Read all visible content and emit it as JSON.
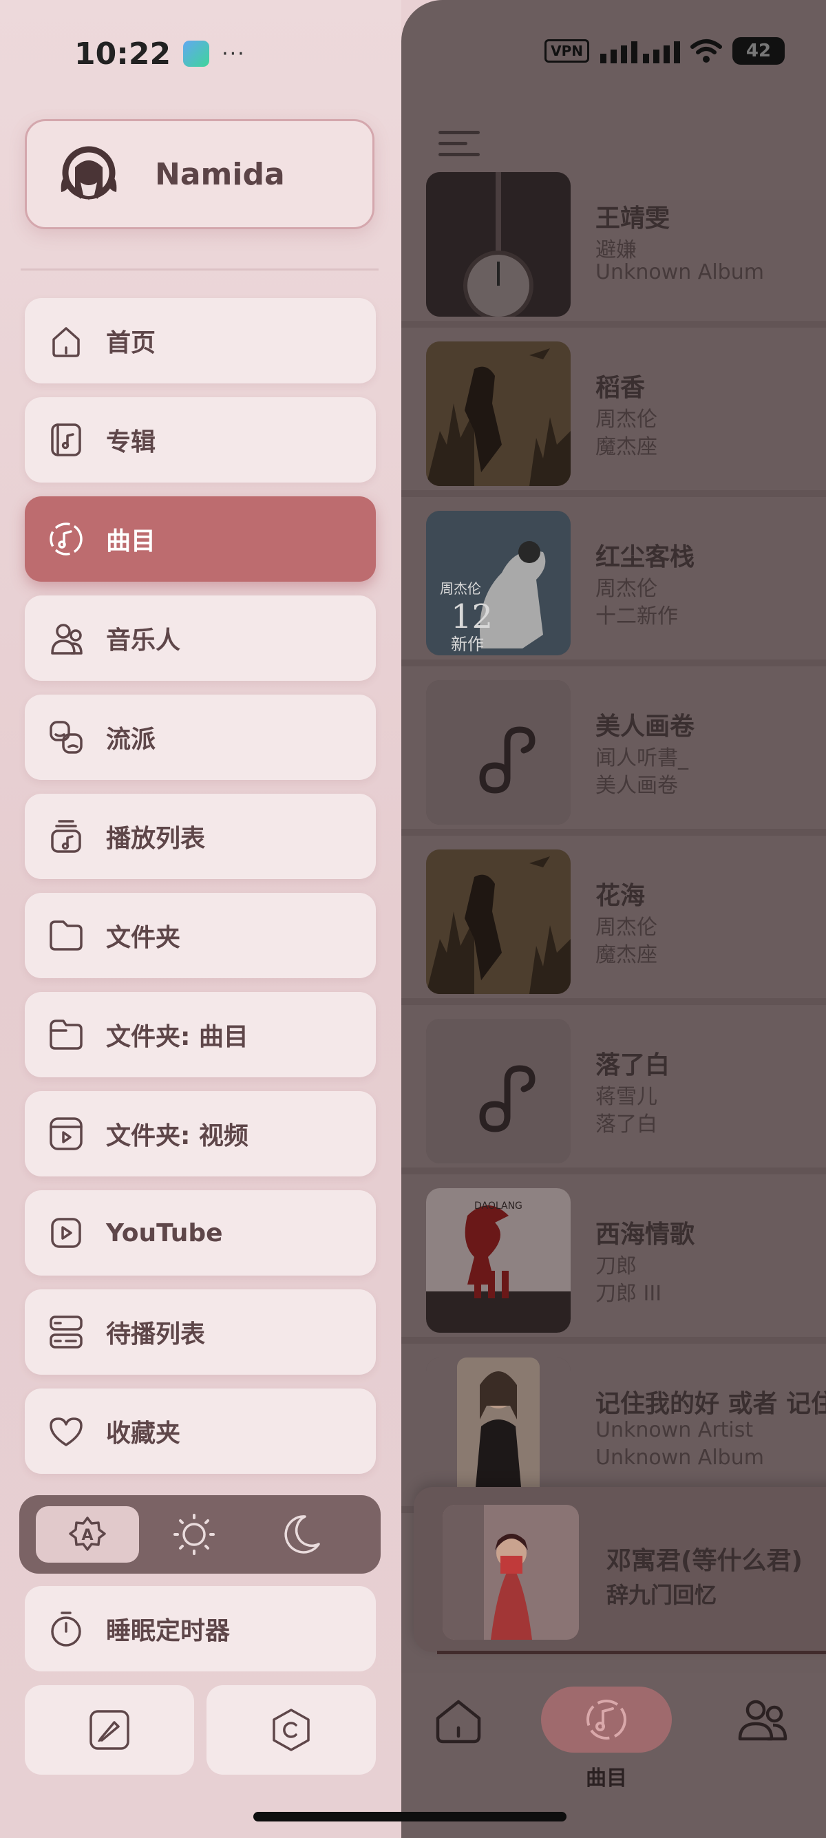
{
  "status_bar": {
    "time": "10:22",
    "dots": "···",
    "vpn": "VPN",
    "battery": "42"
  },
  "profile": {
    "name": "Namida"
  },
  "menu": [
    {
      "label": "首页",
      "icon": "home-icon",
      "active": false
    },
    {
      "label": "专辑",
      "icon": "album-icon",
      "active": false
    },
    {
      "label": "曲目",
      "icon": "tracks-icon",
      "active": true
    },
    {
      "label": "音乐人",
      "icon": "artists-icon",
      "active": false
    },
    {
      "label": "流派",
      "icon": "genres-icon",
      "active": false
    },
    {
      "label": "播放列表",
      "icon": "playlist-icon",
      "active": false
    },
    {
      "label": "文件夹",
      "icon": "folder-icon",
      "active": false
    },
    {
      "label": "文件夹: 曲目",
      "icon": "folder-tracks-icon",
      "active": false
    },
    {
      "label": "文件夹: 视频",
      "icon": "folder-video-icon",
      "active": false
    },
    {
      "label": "YouTube",
      "icon": "youtube-icon",
      "active": false
    },
    {
      "label": "待播列表",
      "icon": "queue-icon",
      "active": false
    },
    {
      "label": "收藏夹",
      "icon": "heart-icon",
      "active": false
    }
  ],
  "theme": {
    "options": [
      "auto-theme-icon",
      "light-theme-icon",
      "dark-theme-icon"
    ],
    "selected": "auto-theme-icon"
  },
  "sleep_timer": {
    "label": "睡眠定时器"
  },
  "songs": [
    {
      "title": "王靖雯",
      "line1": "避嫌",
      "line2": "Unknown Album",
      "cover": "clock"
    },
    {
      "title": "稻香",
      "line1": "周杰伦",
      "line2": "魔杰座",
      "cover": "warrior"
    },
    {
      "title": "红尘客栈",
      "line1": "周杰伦",
      "line2": "十二新作",
      "cover": "horse"
    },
    {
      "title": "美人画卷",
      "line1": "闻人听書_",
      "line2": "美人画卷",
      "cover": "note"
    },
    {
      "title": "花海",
      "line1": "周杰伦",
      "line2": "魔杰座",
      "cover": "warrior"
    },
    {
      "title": "落了白",
      "line1": "蒋雪儿",
      "line2": "落了白",
      "cover": "note"
    },
    {
      "title": "西海情歌",
      "line1": "刀郎",
      "line2": "刀郎 III",
      "cover": "daolang"
    },
    {
      "title": "记住我的好 或者 记住",
      "line1": "Unknown Artist",
      "line2": "Unknown Album",
      "cover": "woman"
    }
  ],
  "cover_texts": {
    "horse_brand": "周杰伦",
    "horse_num": "12",
    "horse_sub": "新作",
    "daolang": "DAOLANG"
  },
  "now_playing": {
    "title": "邓寓君(等什么君)",
    "subtitle": "辞九门回忆"
  },
  "bottom_nav": {
    "active_label": "曲目"
  }
}
